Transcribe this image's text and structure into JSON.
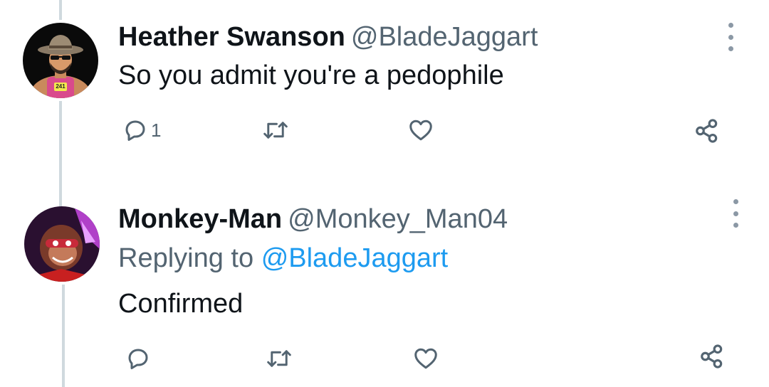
{
  "tweets": [
    {
      "display_name": "Heather Swanson",
      "handle": "@BladeJaggart",
      "text": "So you admit you're a pedophile",
      "reply_count": "1",
      "avatar_icon": "cowboy-cartoon-avatar",
      "avatar_shirt_text": "241"
    },
    {
      "display_name": "Monkey-Man",
      "handle": "@Monkey_Man04",
      "replying_prefix": "Replying to",
      "replying_handle": "@BladeJaggart",
      "text": "Confirmed",
      "avatar_icon": "monkey-cartoon-avatar"
    }
  ],
  "colors": {
    "text": "#0f1419",
    "secondary": "#536471",
    "link": "#1d9bf0",
    "thread_line": "#cfd9de"
  },
  "icons": [
    "reply-icon",
    "retweet-icon",
    "like-icon",
    "share-icon",
    "more-options-icon"
  ]
}
